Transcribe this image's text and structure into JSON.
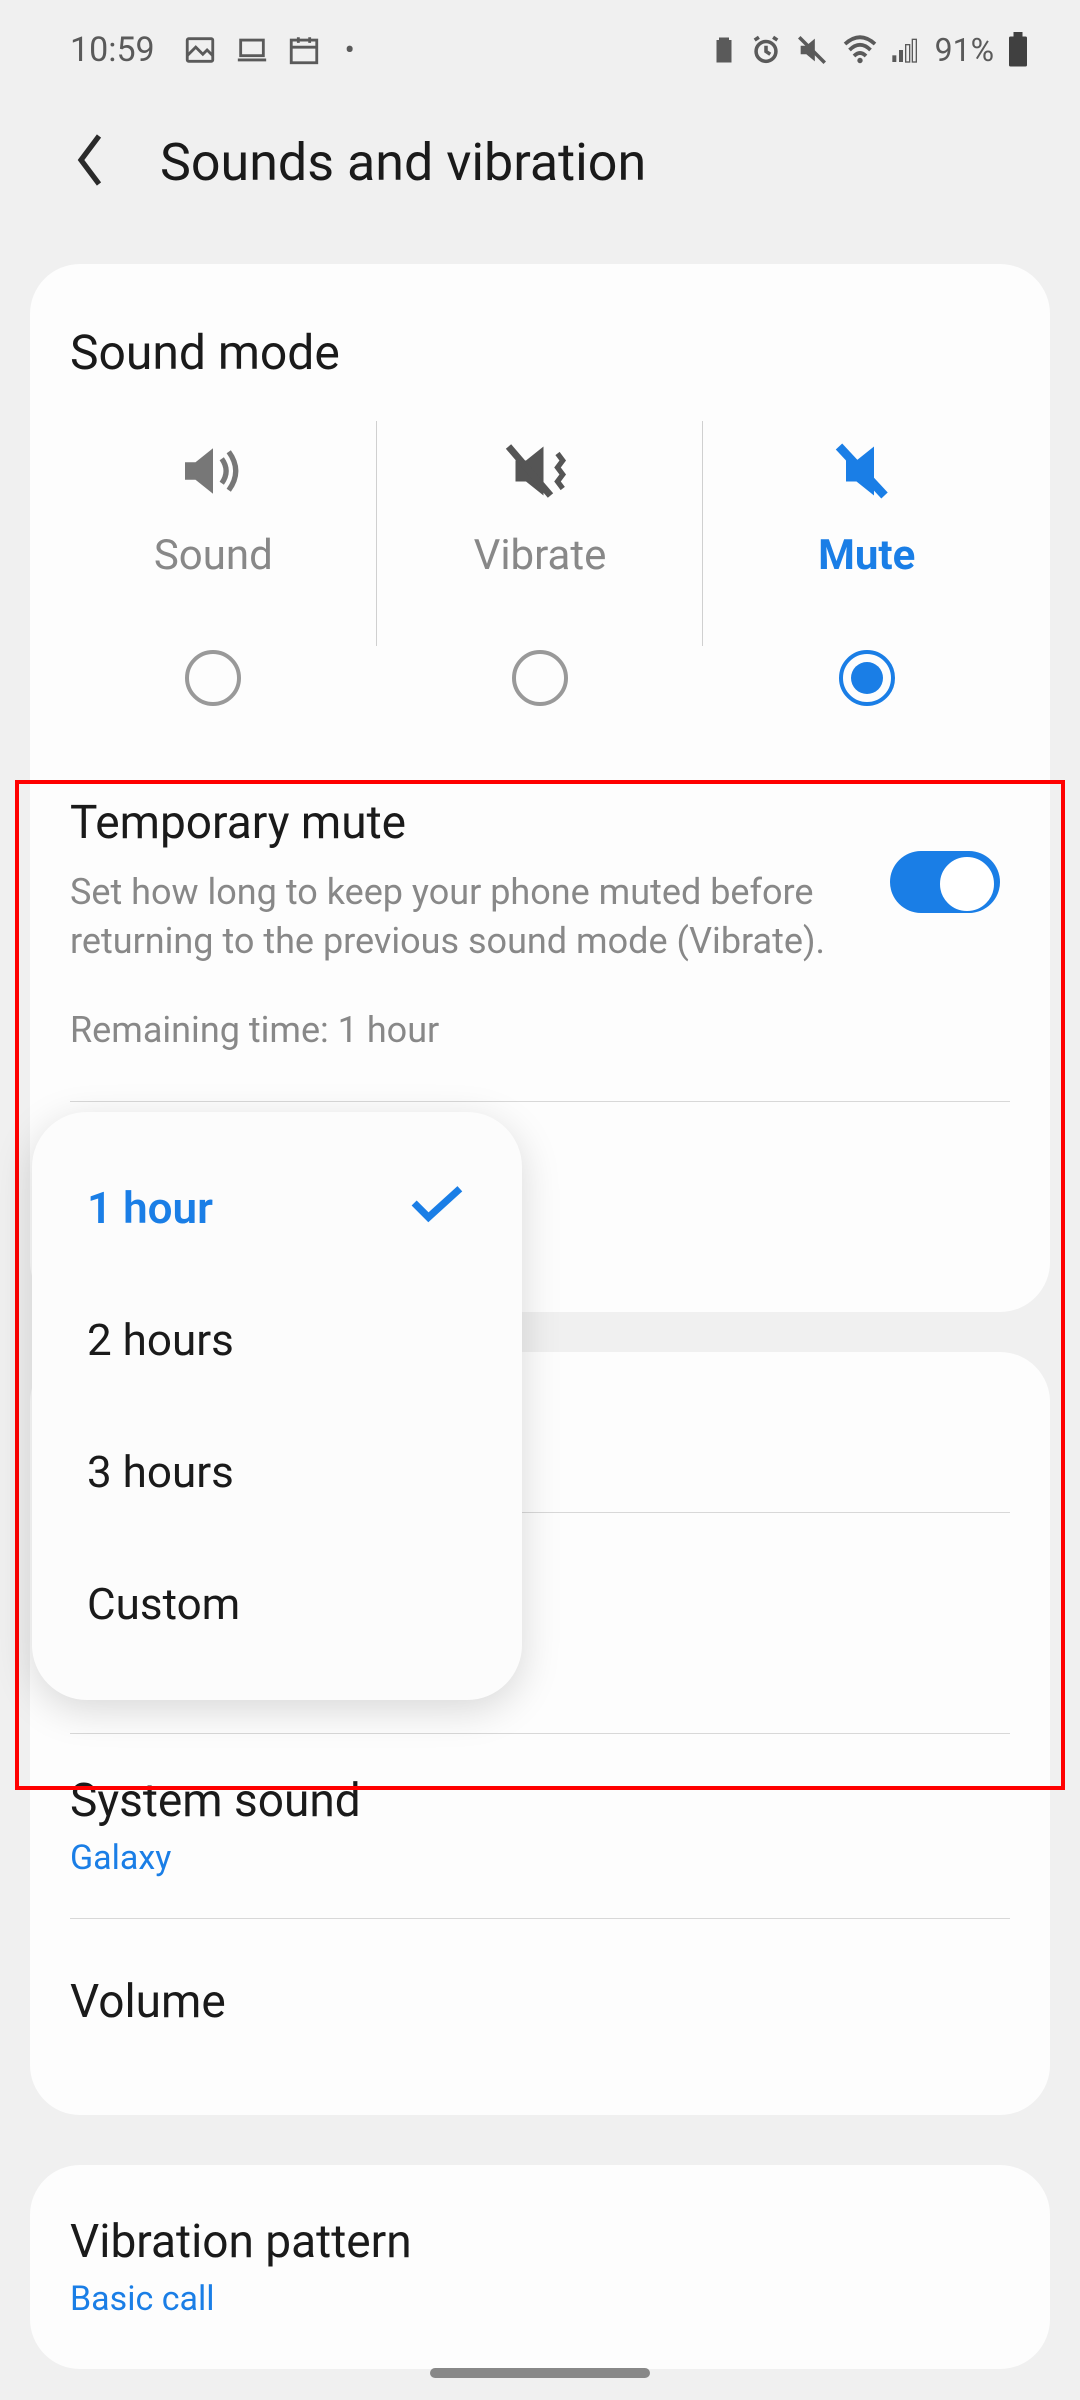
{
  "status": {
    "time": "10:59",
    "battery": "91%"
  },
  "header": {
    "title": "Sounds and vibration"
  },
  "sound_mode": {
    "title": "Sound mode",
    "options": [
      {
        "label": "Sound",
        "selected": false
      },
      {
        "label": "Vibrate",
        "selected": false
      },
      {
        "label": "Mute",
        "selected": true
      }
    ]
  },
  "temporary_mute": {
    "title": "Temporary mute",
    "description": "Set how long to keep your phone muted before returning to the previous sound mode (Vibrate).",
    "remaining": "Remaining time: 1 hour",
    "enabled": true
  },
  "duration_menu": {
    "items": [
      {
        "label": "1 hour",
        "selected": true
      },
      {
        "label": "2 hours",
        "selected": false
      },
      {
        "label": "3 hours",
        "selected": false
      },
      {
        "label": "Custom",
        "selected": false
      }
    ]
  },
  "rows": {
    "system_sound": {
      "title": "System sound",
      "value": "Galaxy"
    },
    "volume": {
      "title": "Volume"
    },
    "vibration_pattern": {
      "title": "Vibration pattern",
      "value": "Basic call"
    }
  }
}
